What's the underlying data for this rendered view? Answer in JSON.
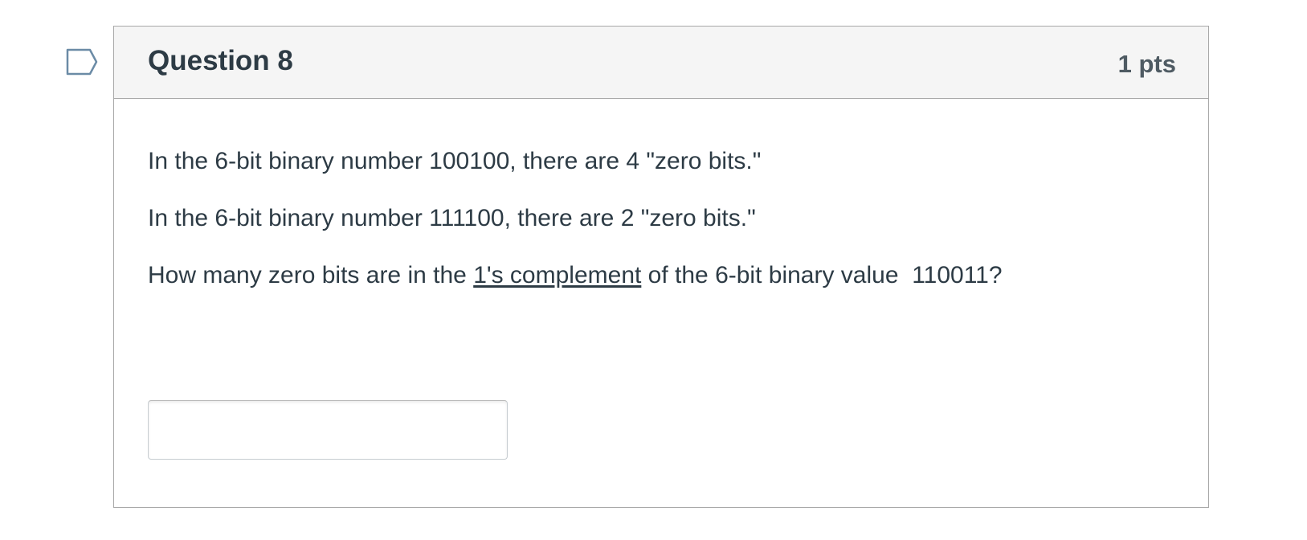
{
  "question": {
    "title": "Question 8",
    "points": "1 pts",
    "flag_icon": "bookmark-flag-icon",
    "lines": [
      {
        "parts": [
          "In the 6-bit binary number 100100, there are 4 \"zero bits.\""
        ]
      },
      {
        "parts": [
          "In the 6-bit binary number 111100, there are 2 \"zero bits.\""
        ]
      },
      {
        "before": "How many zero bits are in the ",
        "underlined": "1's complement",
        "after": " of the 6-bit binary value  110011?"
      }
    ],
    "answer": {
      "value": "",
      "placeholder": ""
    }
  },
  "colors": {
    "header_bg": "#f5f5f5",
    "border": "#a8a8a8",
    "text": "#2d3b45",
    "flag_stroke": "#6b8ba6"
  }
}
